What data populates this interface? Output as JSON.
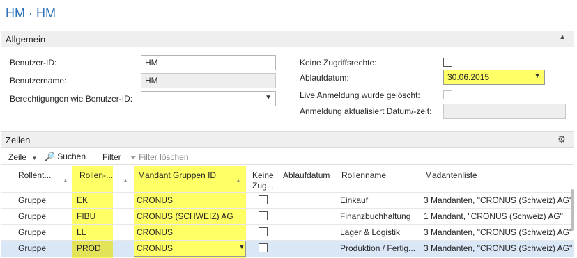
{
  "page": {
    "title": "HM · HM"
  },
  "general": {
    "header": "Allgemein",
    "fields": {
      "user_id": {
        "label": "Benutzer-ID:",
        "value": "HM"
      },
      "user_name": {
        "label": "Benutzername:",
        "value": "HM"
      },
      "permissions_as": {
        "label": "Berechtigungen wie Benutzer-ID:",
        "value": ""
      },
      "no_access": {
        "label": "Keine Zugriffsrechte:"
      },
      "expiry_date": {
        "label": "Ablaufdatum:",
        "value": "30.06.2015"
      },
      "live_login_deleted": {
        "label": "Live Anmeldung wurde gelöscht:"
      },
      "login_updated": {
        "label": "Anmeldung aktualisiert Datum/-zeit:",
        "value": ""
      }
    }
  },
  "lines": {
    "header": "Zeilen",
    "toolbar": {
      "lines_menu": "Zeile",
      "search": "Suchen",
      "filter": "Filter",
      "clear_filter": "Filter löschen"
    },
    "columns": {
      "role_type": "Rollent...",
      "role": "Rollen-...",
      "client_group": "Mandant Gruppen ID",
      "no_access_1": "Keine",
      "no_access_2": "Zug...",
      "expiry": "Ablaufdatum",
      "role_name": "Rollenname",
      "client_list": "Madantenliste"
    },
    "rows": [
      {
        "type": "Gruppe",
        "role": "EK",
        "group": "CRONUS",
        "role_name": "Einkauf",
        "clients": "3 Mandanten, \"CRONUS (Schweiz) AG\","
      },
      {
        "type": "Gruppe",
        "role": "FIBU",
        "group": "CRONUS (SCHWEIZ) AG",
        "role_name": "Finanzbuchhaltung",
        "clients": "1 Mandant, \"CRONUS (Schweiz) AG\""
      },
      {
        "type": "Gruppe",
        "role": "LL",
        "group": "CRONUS",
        "role_name": "Lager & Logistik",
        "clients": "3 Mandanten, \"CRONUS (Schweiz) AG\","
      },
      {
        "type": "Gruppe",
        "role": "PROD",
        "group": "CRONUS",
        "role_name": "Produktion / Fertig...",
        "clients": "3 Mandanten, \"CRONUS (Schweiz) AG\","
      }
    ]
  },
  "colors": {
    "highlight": "#ffff66",
    "title": "#2d72b8",
    "selection": "#d9e7f7"
  },
  "icons": {
    "caret": "chevron-up-icon",
    "search": "binoculars-icon",
    "clear_filter": "funnel-clear-icon",
    "settings": "gears-icon"
  }
}
